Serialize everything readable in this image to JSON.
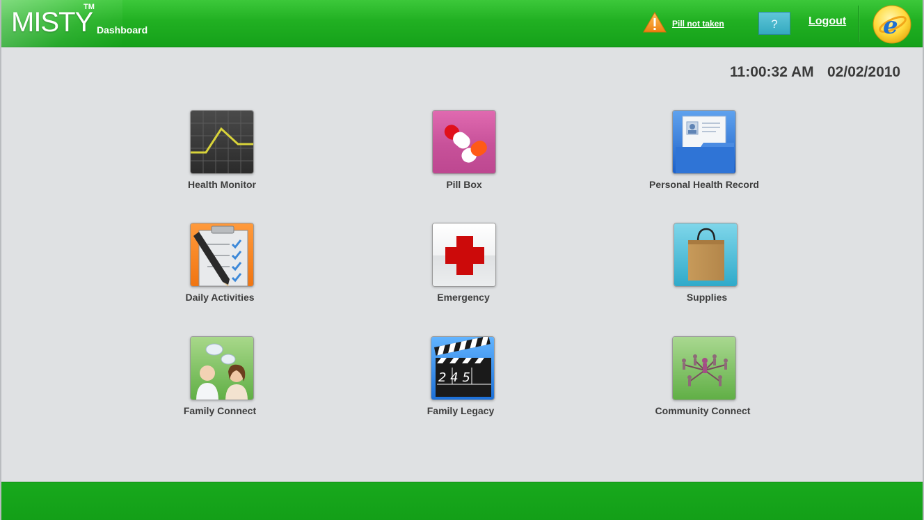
{
  "header": {
    "logo": "MISTY",
    "trademark": "TM",
    "breadcrumb": "Dashboard",
    "alert_text": "Pill not taken",
    "help_label": "?",
    "logout_label": "Logout"
  },
  "clock": {
    "time": "11:00:32 AM",
    "date": "02/02/2010"
  },
  "tiles": [
    {
      "label": "Health Monitor",
      "icon": "health-monitor-icon"
    },
    {
      "label": "Pill Box",
      "icon": "pill-box-icon"
    },
    {
      "label": "Personal Health Record",
      "icon": "health-record-icon"
    },
    {
      "label": "Daily Activities",
      "icon": "daily-activities-icon"
    },
    {
      "label": "Emergency",
      "icon": "emergency-icon"
    },
    {
      "label": "Supplies",
      "icon": "supplies-icon"
    },
    {
      "label": "Family Connect",
      "icon": "family-connect-icon"
    },
    {
      "label": "Family Legacy",
      "icon": "family-legacy-icon"
    },
    {
      "label": "Community Connect",
      "icon": "community-connect-icon"
    }
  ],
  "clapper_numbers": "2 4 5",
  "colors": {
    "header_green": "#21b022",
    "footer_green": "#15a31a",
    "background": "#dfe1e3",
    "warning_orange": "#f29a1e"
  }
}
